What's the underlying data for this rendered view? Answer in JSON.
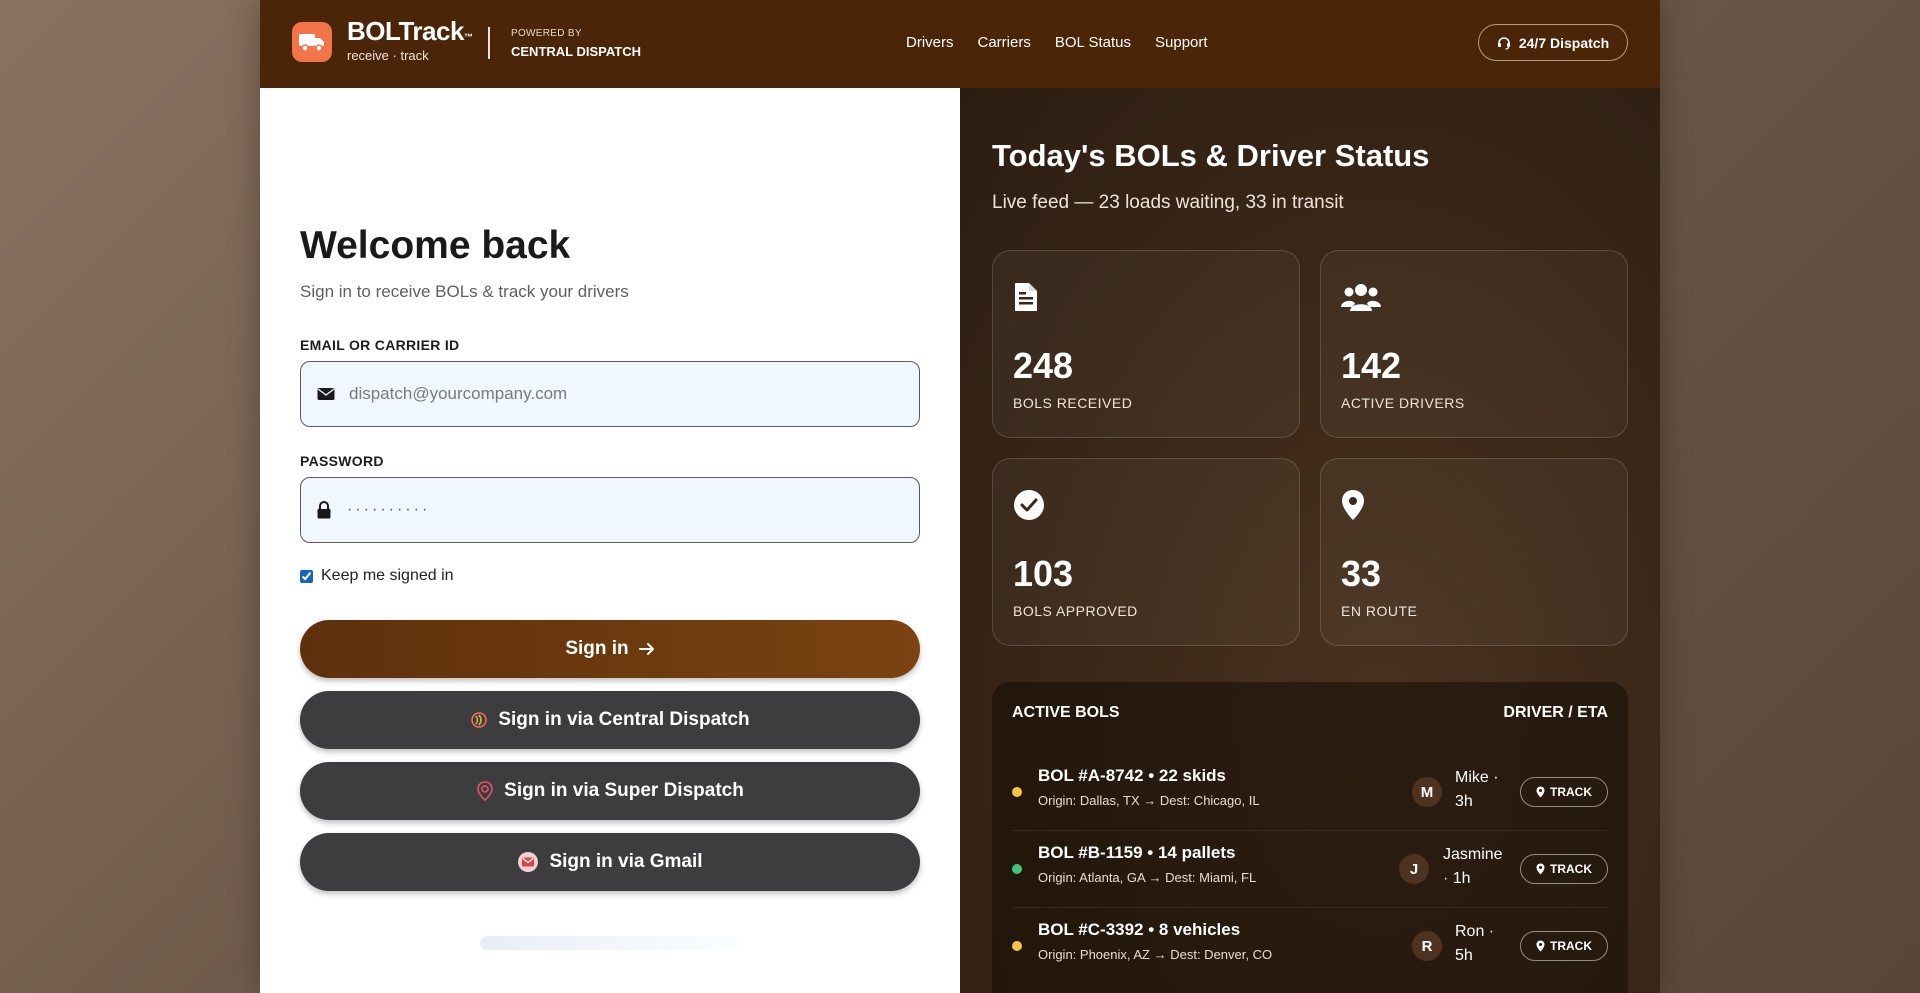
{
  "header": {
    "brand_name": "BOLTrack",
    "brand_tm": "™",
    "brand_tagline": "receive · track",
    "powered_by_label": "POWERED BY",
    "powered_by_name": "CENTRAL DISPATCH",
    "nav": [
      "Drivers",
      "Carriers",
      "BOL Status",
      "Support"
    ],
    "dispatch_button": "24/7 Dispatch",
    "accent_color": "#f2754a",
    "bar_color": "#4a2508"
  },
  "login": {
    "title": "Welcome back",
    "subtitle": "Sign in to receive BOLs & track your drivers",
    "email_label": "EMAIL OR CARRIER ID",
    "email_placeholder": "dispatch@yourcompany.com",
    "password_label": "PASSWORD",
    "password_value": "··········",
    "remember_label": "Keep me signed in",
    "remember_checked": true,
    "sign_in_button": "Sign in",
    "alt_buttons": [
      "Sign in via Central Dispatch",
      "Sign in via Super Dispatch",
      "Sign in via Gmail"
    ]
  },
  "status": {
    "title": "Today's BOLs & Driver Status",
    "subtitle": "Live feed — 23 loads waiting, 33 in transit",
    "stats": [
      {
        "value": "248",
        "label": "BOLS RECEIVED",
        "icon": "document-icon"
      },
      {
        "value": "142",
        "label": "ACTIVE DRIVERS",
        "icon": "users-icon"
      },
      {
        "value": "103",
        "label": "BOLS APPROVED",
        "icon": "check-circle-icon"
      },
      {
        "value": "33",
        "label": "EN ROUTE",
        "icon": "map-pin-icon"
      }
    ],
    "active_bols": {
      "heading": "ACTIVE BOLS",
      "heading_right": "DRIVER / ETA",
      "track_label": "TRACK",
      "rows": [
        {
          "title": "BOL #A-8742 • 22 skids",
          "route": "Origin: Dallas, TX → Dest: Chicago, IL",
          "initial": "M",
          "driver_line1": "Mike ·",
          "driver_line2": "3h",
          "status_color": "#f5c542"
        },
        {
          "title": "BOL #B-1159 • 14 pallets",
          "route": "Origin: Atlanta, GA → Dest: Miami, FL",
          "initial": "J",
          "driver_line1": "Jasmine",
          "driver_line2": "· 1h",
          "status_color": "#3ec47a"
        },
        {
          "title": "BOL #C-3392 • 8 vehicles",
          "route": "Origin: Phoenix, AZ → Dest: Denver, CO",
          "initial": "R",
          "driver_line1": "Ron ·",
          "driver_line2": "5h",
          "status_color": "#f5c542"
        }
      ]
    }
  }
}
